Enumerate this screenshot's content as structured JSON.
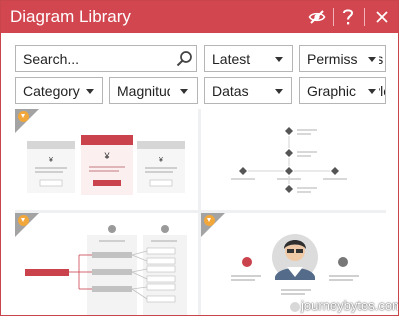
{
  "window": {
    "title": "Diagram Library"
  },
  "search": {
    "value": "Search..."
  },
  "sort": {
    "selected": "Latest"
  },
  "permissions": {
    "selected": "Permissions"
  },
  "category": {
    "selected": "Category"
  },
  "magnitude": {
    "selected": "Magnitude"
  },
  "datas": {
    "selected": "Datas"
  },
  "graphic": {
    "selected": "Graphic Style"
  },
  "templates": [
    {
      "premium": true
    },
    {
      "premium": false
    },
    {
      "premium": true
    },
    {
      "premium": true
    }
  ],
  "colors": {
    "accent": "#d2464f"
  },
  "watermark": {
    "text": "journeybytes.com"
  }
}
